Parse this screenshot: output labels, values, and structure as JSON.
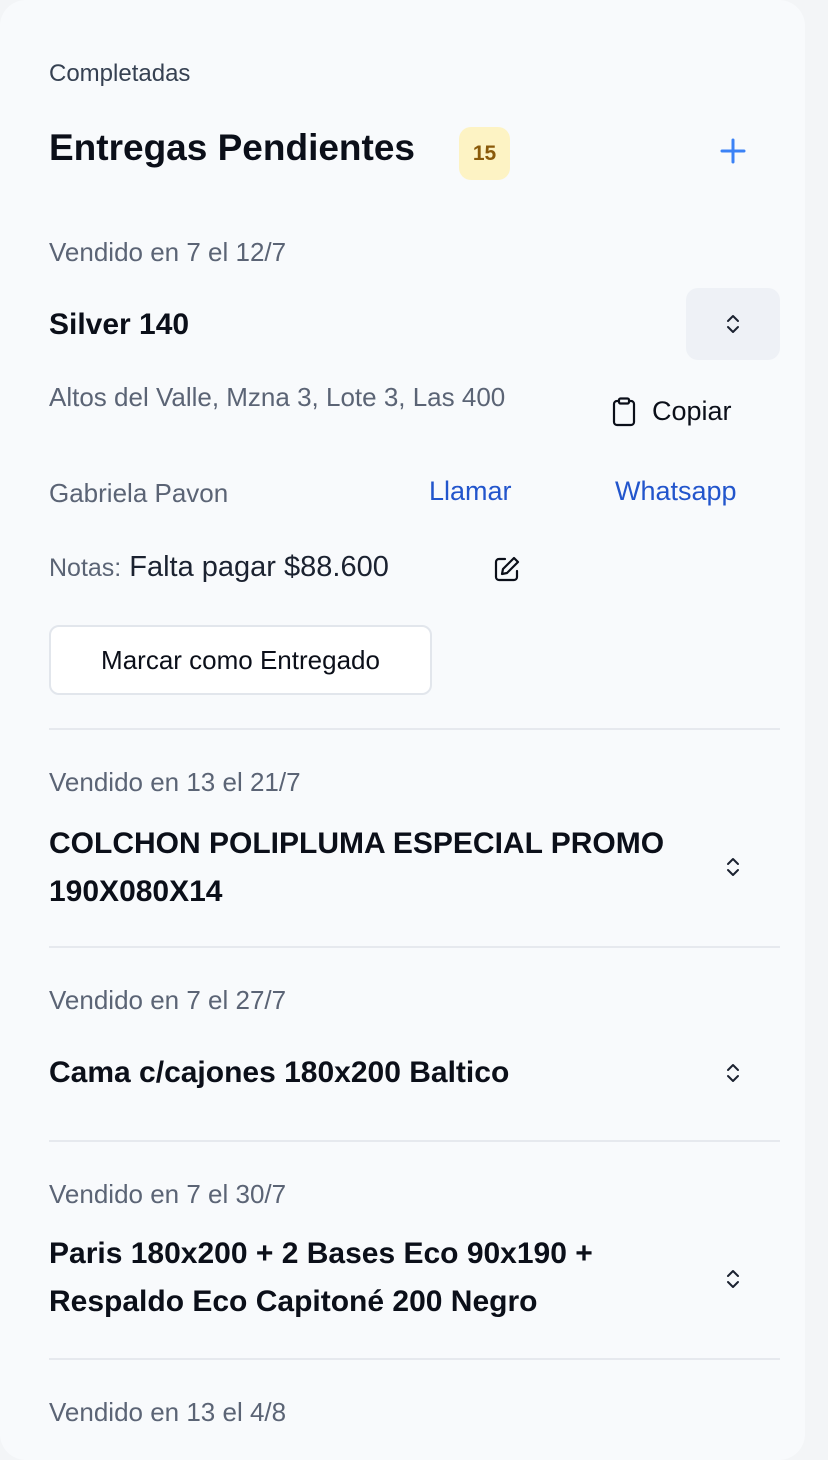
{
  "tabs": {
    "completed_label": "Completadas"
  },
  "header": {
    "title": "Entregas Pendientes",
    "count": "15"
  },
  "expanded": {
    "sold": "Vendido en 7 el 12/7",
    "title": "Silver 140",
    "address": "Altos del Valle, Mzna 3, Lote 3, Las 400",
    "copy_label": "Copiar",
    "contact_name": "Gabriela Pavon",
    "call_label": "Llamar",
    "whatsapp_label": "Whatsapp",
    "notes_label": "Notas:",
    "notes_value": "Falta pagar $88.600",
    "mark_delivered_label": "Marcar como Entregado"
  },
  "items": [
    {
      "sold": "Vendido en 13 el 21/7",
      "title": "COLCHON POLIPLUMA ESPECIAL PROMO 190X080X14"
    },
    {
      "sold": "Vendido en 7 el 27/7",
      "title": "Cama c/cajones 180x200 Baltico"
    },
    {
      "sold": "Vendido en 7 el 30/7",
      "title": "Paris 180x200 + 2 Bases Eco 90x190 + Respaldo Eco Capitoné 200 Negro"
    },
    {
      "sold": "Vendido en 13 el 4/8",
      "title": ""
    }
  ],
  "colors": {
    "link": "#2255cc",
    "accent_plus": "#3b82f6",
    "badge_bg": "#fdf3c4",
    "badge_text": "#8a5a0a"
  },
  "icons": [
    "plus-icon",
    "chevron-up-down-icon",
    "clipboard-icon",
    "edit-note-icon"
  ]
}
